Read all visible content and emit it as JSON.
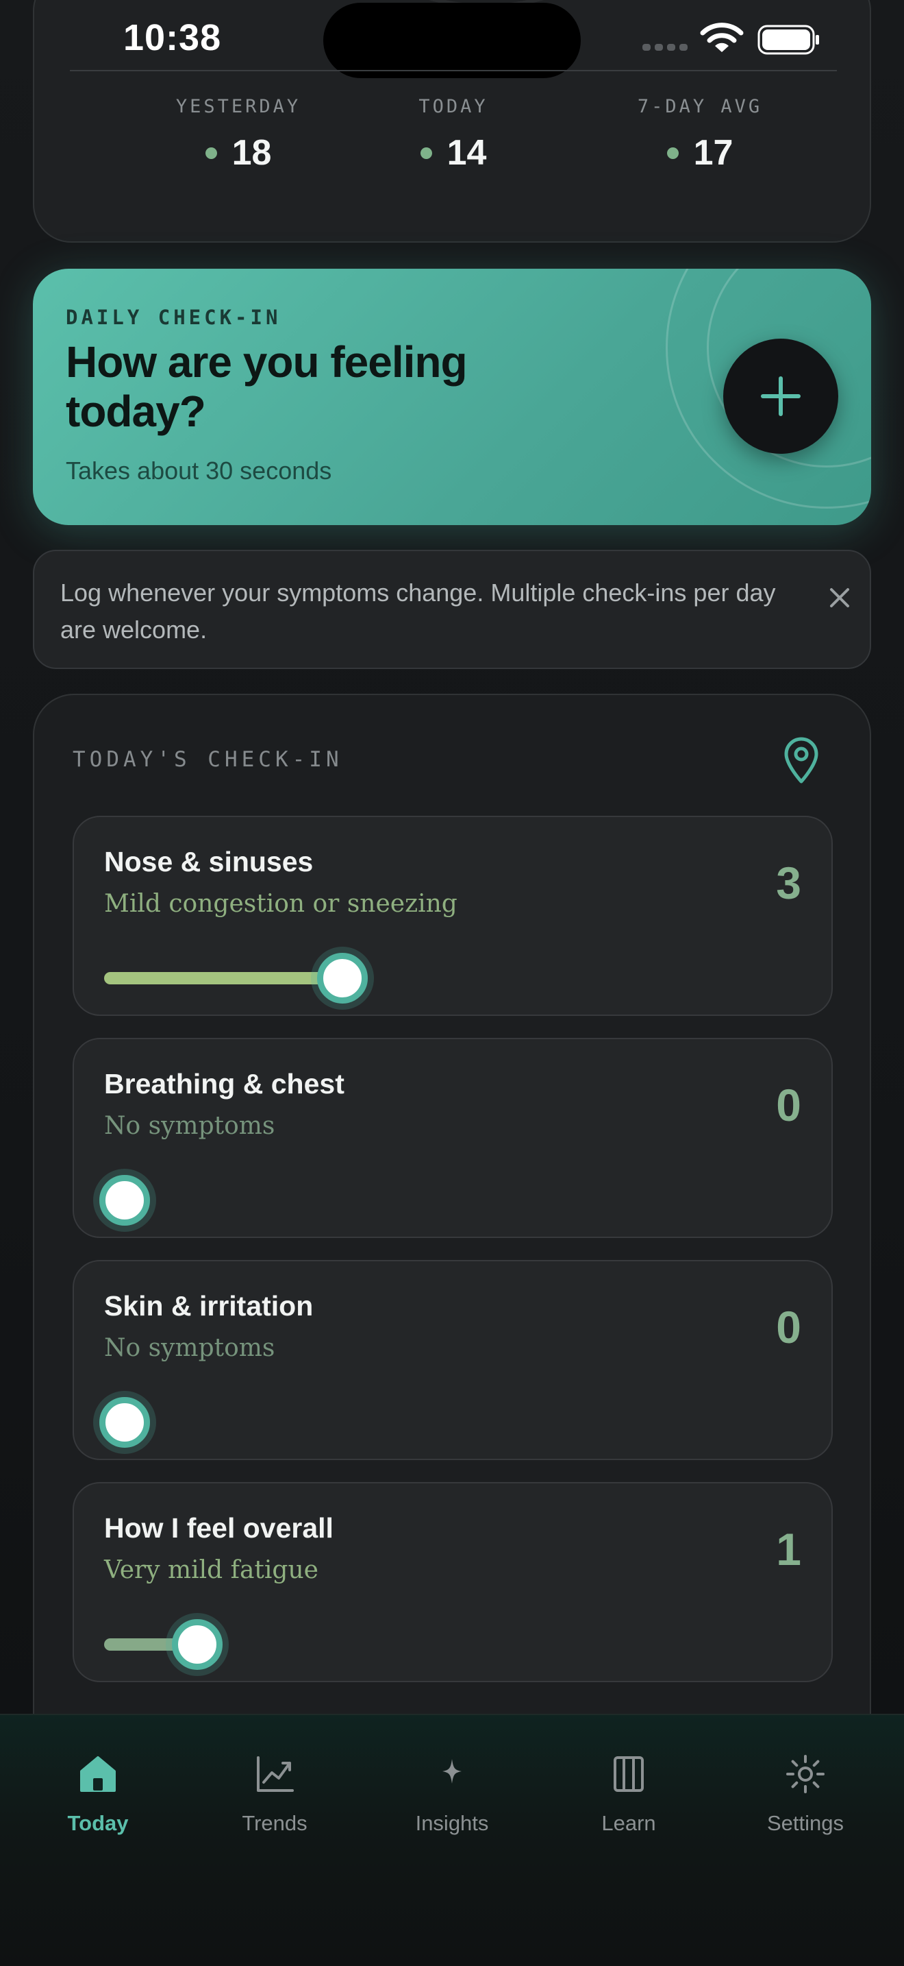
{
  "status_bar": {
    "time": "10:38"
  },
  "stats": [
    {
      "label": "YESTERDAY",
      "value": "18"
    },
    {
      "label": "TODAY",
      "value": "14"
    },
    {
      "label": "7-DAY AVG",
      "value": "17"
    }
  ],
  "daily_checkin": {
    "eyebrow": "DAILY CHECK-IN",
    "title": "How are you feeling today?",
    "subtitle": "Takes about 30 seconds",
    "add_icon": "plus-icon"
  },
  "tip": {
    "text": "Log whenever your symptoms change. Multiple check-ins per day are welcome.",
    "close_icon": "close-icon"
  },
  "today_checkin": {
    "title": "TODAY'S CHECK-IN",
    "location_icon": "map-pin-icon",
    "symptoms": [
      {
        "name": "Nose & sinuses",
        "description": "Mild congestion or sneezing",
        "score": "3",
        "level": 0.3
      },
      {
        "name": "Breathing & chest",
        "description": "No symptoms",
        "score": "0",
        "level": 0
      },
      {
        "name": "Skin & irritation",
        "description": "No symptoms",
        "score": "0",
        "level": 0
      },
      {
        "name": "How I feel overall",
        "description": "Very mild fatigue",
        "score": "1",
        "level": 0.1
      }
    ]
  },
  "nav": {
    "items": [
      {
        "label": "Today",
        "icon": "home-icon",
        "active": true
      },
      {
        "label": "Trends",
        "icon": "trend-chart-icon",
        "active": false
      },
      {
        "label": "Insights",
        "icon": "sparkle-icon",
        "active": false
      },
      {
        "label": "Learn",
        "icon": "book-icon",
        "active": false
      },
      {
        "label": "Settings",
        "icon": "gear-icon",
        "active": false
      }
    ]
  },
  "colors": {
    "accent": "#5bbfab",
    "score_green": "#86b08e",
    "card_bg": "#242628"
  }
}
